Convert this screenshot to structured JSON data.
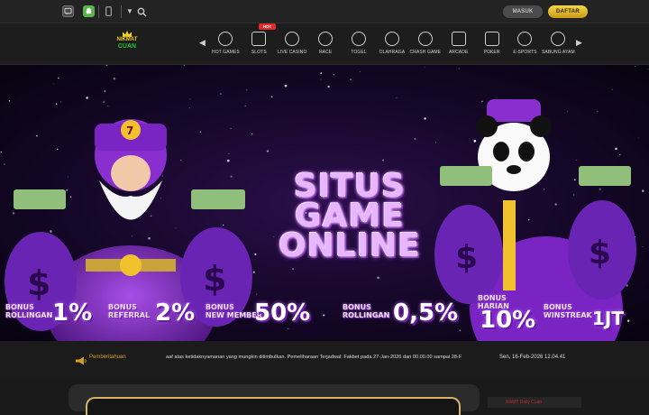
{
  "topbar": {
    "login_label": "MASUK",
    "register_label": "DAFTAR"
  },
  "logo": {
    "line1": "NIKMAT",
    "line2": "CUAN"
  },
  "nav": {
    "hot_badge": "HOT",
    "items": [
      {
        "label": "HOT GAMES",
        "icon": "fire-icon"
      },
      {
        "label": "SLOTS",
        "icon": "slot-machine-icon"
      },
      {
        "label": "LIVE CASINO",
        "icon": "casino-chip-icon"
      },
      {
        "label": "RACE",
        "icon": "race-icon"
      },
      {
        "label": "TOGEL",
        "icon": "lottery-ball-icon"
      },
      {
        "label": "OLAHRAGA",
        "icon": "soccer-ball-icon"
      },
      {
        "label": "CRASH GAME",
        "icon": "rocket-icon"
      },
      {
        "label": "ARCADE",
        "icon": "arcade-icon"
      },
      {
        "label": "POKER",
        "icon": "cards-icon"
      },
      {
        "label": "E-SPORTS",
        "icon": "gamepad-icon"
      },
      {
        "label": "SABUNG AYAM",
        "icon": "rooster-icon"
      }
    ]
  },
  "banner": {
    "title_lines": [
      "SITUS",
      "GAME",
      "ONLINE"
    ],
    "promos": [
      {
        "label": [
          "BONUS",
          "ROLLINGAN"
        ],
        "value": "1%"
      },
      {
        "label": [
          "BONUS",
          "REFERRAL"
        ],
        "value": "2%"
      },
      {
        "label": [
          "BONUS",
          "NEW MEMBER"
        ],
        "value": "50%"
      },
      {
        "label": [
          "BONUS",
          "ROLLINGAN"
        ],
        "value": "0,5%"
      },
      {
        "label": [
          "BONUS",
          "HARIAN"
        ],
        "value": "10%"
      },
      {
        "label": [
          "BONUS",
          "WINSTREAK"
        ],
        "value": "1JT"
      }
    ]
  },
  "ticker": {
    "label": "Pemberitahuan",
    "text": "aaf atas ketidaknyamanan yang mungkin ditimbulkan.     Pemeliharaan Terjadwal: Fakbet pada 27-Jan-2026 dari 00.00.00 sampai 28-F",
    "datetime": "Sen, 16-Feb-2026 12.04.41"
  },
  "sidebar_card": {
    "title": "NikMT Daily Cuan"
  },
  "colors": {
    "accent_gold": "#f2c12e",
    "banner_purple": "#7b2cbf",
    "hot_red": "#e22b2b"
  }
}
